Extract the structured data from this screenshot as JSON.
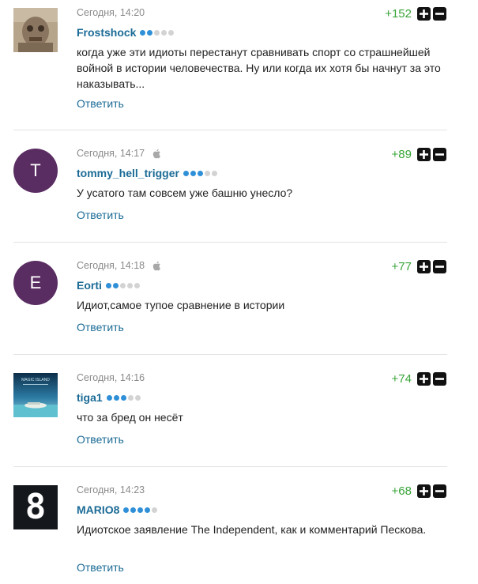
{
  "comments": [
    {
      "time": "Сегодня, 14:20",
      "username": "Frostshock",
      "rating_level": 2,
      "score": "+152",
      "text": "когда уже эти идиоты перестанут сравнивать спорт со страшнейшей войной в истории человечества. Ну или когда их хотя бы начнут за это наказывать...",
      "reply": "Ответить",
      "avatar": {
        "type": "image",
        "icon": "gargoyle-photo"
      }
    },
    {
      "time": "Сегодня, 14:17",
      "username": "tommy_hell_trigger",
      "rating_level": 3,
      "score": "+89",
      "text": "У усатого там совсем уже башню унесло?",
      "reply": "Ответить",
      "avatar": {
        "type": "letter",
        "letter": "T",
        "color": "#5a2d62"
      },
      "apple": true
    },
    {
      "time": "Сегодня, 14:18",
      "username": "Eorti",
      "rating_level": 2,
      "score": "+77",
      "text": "Идиот,самое тупое сравнение в истории",
      "reply": "Ответить",
      "avatar": {
        "type": "letter",
        "letter": "E",
        "color": "#5a2d62"
      },
      "apple": true
    },
    {
      "time": "Сегодня, 14:16",
      "username": "tiga1",
      "rating_level": 3,
      "score": "+74",
      "text": "что за бред он несёт",
      "reply": "Ответить",
      "avatar": {
        "type": "image",
        "icon": "magic-island-photo",
        "caption": "MAGIC ISLAND"
      }
    },
    {
      "time": "Сегодня, 14:23",
      "username": "MARIO8",
      "rating_level": 4,
      "score": "+68",
      "text": "Идиотское заявление The Independent, как и комментарий Пескова.",
      "reply": "Ответить",
      "avatar": {
        "type": "image",
        "icon": "number-8-badge",
        "letter": "8"
      }
    }
  ],
  "colors": {
    "link": "#1b6b96",
    "score": "#3aa53a",
    "dot_active": "#2f90d8",
    "dot_inactive": "#d3d3d3"
  }
}
